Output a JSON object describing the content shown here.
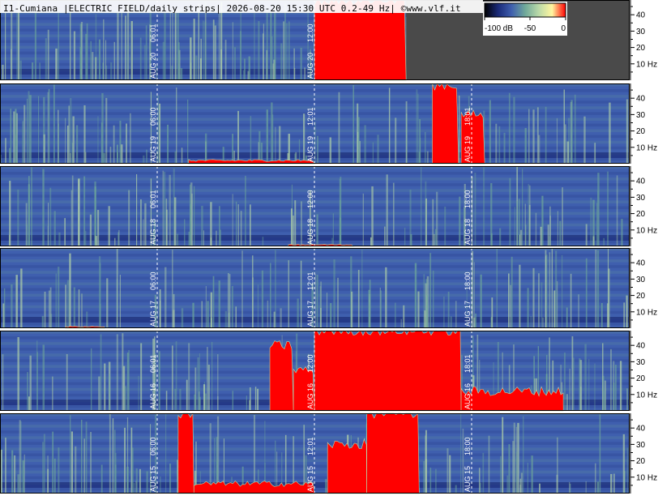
{
  "title": "I1-Cumiana |ELECTRIC FIELD/daily strips| 2026-08-20 15:30 UTC 0.2-49 Hz| ©www.vlf.it",
  "colorbar": {
    "labels": [
      "-100 dB",
      "-50",
      "0"
    ],
    "colors": [
      "#000000",
      "#1a2a78",
      "#3f5fae",
      "#6fa89a",
      "#b9d9a8",
      "#fff6a0",
      "#ff0000"
    ]
  },
  "colors": {
    "background_fill": "#4a4a4a",
    "low": "#1a2a78",
    "mid": "#3f5fae",
    "green": "#6fa89a",
    "pale": "#b9d9a8",
    "sat": "#ff0000"
  },
  "chart_data": {
    "type": "heatmap",
    "title": "I1-Cumiana |ELECTRIC FIELD/daily strips| 2026-08-20 15:30 UTC 0.2-49 Hz| ©www.vlf.it",
    "xlabel": "",
    "ylabel": "",
    "y_ticks": [
      "40",
      "30",
      "20",
      "10 Hz"
    ],
    "y_tick_values": [
      40,
      30,
      20,
      10
    ],
    "ylim": [
      0,
      49
    ],
    "strips": [
      {
        "day": "AUG 20",
        "markers": [
          {
            "hour": 6,
            "time": "06:01",
            "date": "AUG 20"
          },
          {
            "hour": 12,
            "time": "12:00",
            "date": "AUG 20"
          }
        ],
        "data_end_hour": 15.5,
        "saturation": [
          [
            12.0,
            15.5,
            49
          ]
        ]
      },
      {
        "day": "AUG 19",
        "markers": [
          {
            "hour": 6,
            "time": "06:00",
            "date": "AUG 19"
          },
          {
            "hour": 12,
            "time": "12:01",
            "date": "AUG 19"
          },
          {
            "hour": 18,
            "time": "18:01",
            "date": "AUG 19"
          }
        ],
        "saturation": [
          [
            7.2,
            12.0,
            2
          ],
          [
            16.5,
            17.5,
            48
          ],
          [
            17.6,
            18.5,
            30
          ]
        ]
      },
      {
        "day": "AUG 18",
        "markers": [
          {
            "hour": 6,
            "time": "06:01",
            "date": "AUG 18"
          },
          {
            "hour": 12,
            "time": "12:00",
            "date": "AUG 18"
          },
          {
            "hour": 18,
            "time": "18:00",
            "date": "AUG 18"
          }
        ],
        "saturation": [
          [
            11.0,
            13.5,
            1
          ]
        ]
      },
      {
        "day": "AUG 17",
        "markers": [
          {
            "hour": 6,
            "time": "06:00",
            "date": "AUG 17"
          },
          {
            "hour": 12,
            "time": "12:01",
            "date": "AUG 17"
          },
          {
            "hour": 18,
            "time": "18:00",
            "date": "AUG 17"
          }
        ],
        "saturation": [
          [
            2.5,
            4.0,
            1
          ]
        ]
      },
      {
        "day": "AUG 16",
        "markers": [
          {
            "hour": 6,
            "time": "06:01",
            "date": "AUG 16"
          },
          {
            "hour": 12,
            "time": "12:00",
            "date": "AUG 16"
          },
          {
            "hour": 18,
            "time": "18:01",
            "date": "AUG 16"
          }
        ],
        "saturation": [
          [
            10.3,
            11.2,
            40
          ],
          [
            11.2,
            12.0,
            25
          ],
          [
            12.0,
            17.6,
            49
          ],
          [
            17.6,
            21.5,
            12
          ]
        ]
      },
      {
        "day": "AUG 15",
        "markers": [
          {
            "hour": 6,
            "time": "06:00",
            "date": "AUG 15"
          },
          {
            "hour": 12,
            "time": "12:01",
            "date": "AUG 15"
          },
          {
            "hour": 18,
            "time": "18:00",
            "date": "AUG 15"
          }
        ],
        "saturation": [
          [
            6.8,
            7.4,
            49
          ],
          [
            7.4,
            12.0,
            6
          ],
          [
            12.5,
            14.0,
            30
          ],
          [
            14.0,
            16.0,
            49
          ]
        ]
      }
    ]
  }
}
